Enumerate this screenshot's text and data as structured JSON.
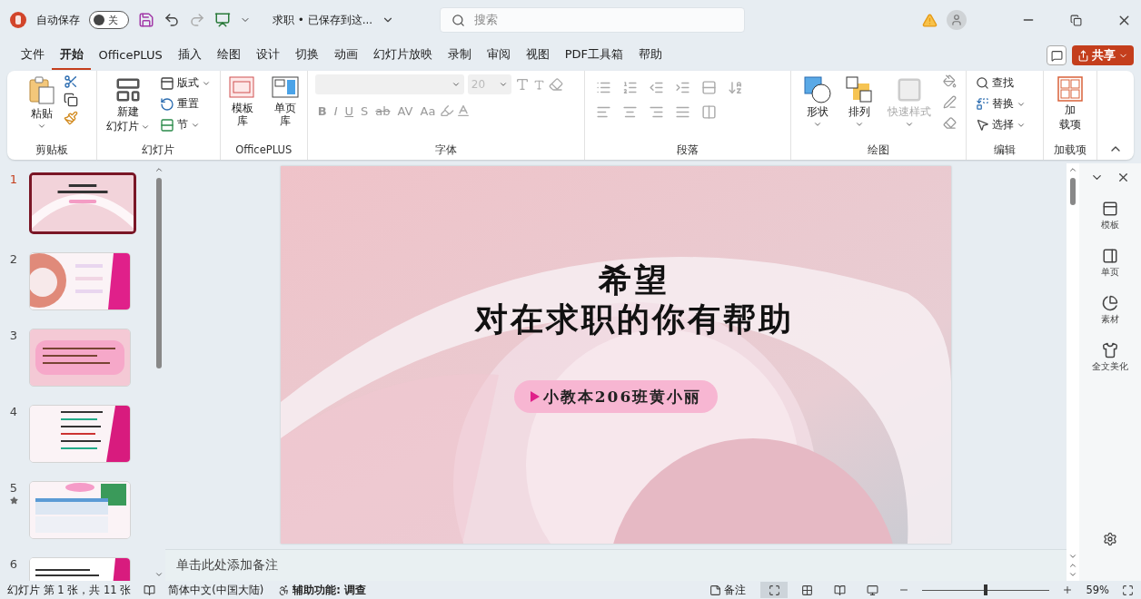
{
  "title_bar": {
    "autosave_label": "自动保存",
    "autosave_toggle": {
      "on": false,
      "label": "关"
    },
    "document_title": "求职 • 已保存到这...",
    "search": {
      "placeholder": "搜索"
    }
  },
  "menu_tabs": [
    {
      "label": "文件",
      "selected": false
    },
    {
      "label": "开始",
      "selected": true
    },
    {
      "label": "OfficePLUS",
      "selected": false
    },
    {
      "label": "插入",
      "selected": false
    },
    {
      "label": "绘图",
      "selected": false
    },
    {
      "label": "设计",
      "selected": false
    },
    {
      "label": "切换",
      "selected": false
    },
    {
      "label": "动画",
      "selected": false
    },
    {
      "label": "幻灯片放映",
      "selected": false
    },
    {
      "label": "录制",
      "selected": false
    },
    {
      "label": "审阅",
      "selected": false
    },
    {
      "label": "视图",
      "selected": false
    },
    {
      "label": "PDF工具箱",
      "selected": false
    },
    {
      "label": "帮助",
      "selected": false
    }
  ],
  "share_button": "共享",
  "ribbon": {
    "groups": [
      {
        "kind": "clipboard",
        "label": "剪贴板",
        "paste": "粘贴"
      },
      {
        "kind": "slides",
        "label": "幻灯片",
        "new_slide": [
          "新建",
          "幻灯片"
        ],
        "items": [
          "版式",
          "重置",
          "节"
        ]
      },
      {
        "kind": "officeplus",
        "label": "OfficePLUS",
        "items": [
          "模板库",
          "单页库"
        ]
      },
      {
        "kind": "font",
        "label": "字体",
        "font_size": "20",
        "format_buttons": [
          "B",
          "I",
          "U",
          "S",
          "ab",
          "AV",
          "Aa"
        ]
      },
      {
        "kind": "paragraph",
        "label": "段落"
      },
      {
        "kind": "drawing",
        "label": "绘图",
        "items": [
          {
            "label": "形状",
            "disabled": false
          },
          {
            "label": "排列",
            "disabled": false
          },
          {
            "label": "快速样式",
            "disabled": true
          }
        ]
      },
      {
        "kind": "editing",
        "label": "编辑",
        "items": [
          "查找",
          "替换",
          "选择"
        ]
      },
      {
        "kind": "addins",
        "label": "加载项",
        "button": [
          "加",
          "载项"
        ]
      }
    ]
  },
  "slides": [
    {
      "number": "1",
      "selected": true,
      "animated": false
    },
    {
      "number": "2",
      "selected": false,
      "animated": false
    },
    {
      "number": "3",
      "selected": false,
      "animated": false
    },
    {
      "number": "4",
      "selected": false,
      "animated": false
    },
    {
      "number": "5",
      "selected": false,
      "animated": true
    },
    {
      "number": "6",
      "selected": false,
      "animated": false
    }
  ],
  "slide": {
    "title_lines": [
      "希望",
      "对在求职的你有帮助"
    ],
    "subtitle": "小教本206班黄小丽"
  },
  "notes": {
    "placeholder": "单击此处添加备注"
  },
  "side_pane": {
    "items": [
      "模板",
      "单页",
      "素材",
      "全文美化"
    ]
  },
  "status_bar": {
    "slide_info": "幻灯片 第 1 张，共 11 张",
    "language": "简体中文(中国大陆)",
    "accessibility": "辅助功能: 调查",
    "notes_button": "备注",
    "view_buttons": [
      {
        "selected": true
      },
      {
        "selected": false
      },
      {
        "selected": false
      },
      {
        "selected": false
      }
    ],
    "zoom": {
      "level": 0.5,
      "reading": "59%"
    }
  }
}
